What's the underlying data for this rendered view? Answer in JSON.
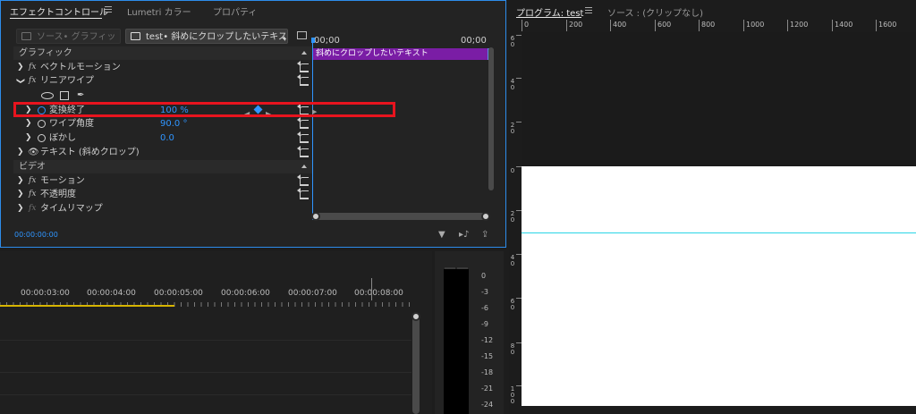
{
  "effect_controls": {
    "tabs": [
      {
        "label": "エフェクトコントロール",
        "active": true
      },
      {
        "label": "Lumetri カラー",
        "active": false
      },
      {
        "label": "プロパティ",
        "active": false
      }
    ],
    "source_button": "ソース• グラフィック",
    "clip_button": "test• 斜めにクロップしたいテキスト",
    "time_start": "00;00",
    "time_end": "00;00",
    "clip_bar_label": "斜めにクロップしたいテキスト",
    "rows": {
      "graphic_header": "グラフィック",
      "vector_motion": "ベクトルモーション",
      "linear_wipe": "リニアワイプ",
      "transition_completion": "変換終了",
      "transition_completion_value": "100 %",
      "wipe_angle": "ワイプ角度",
      "wipe_angle_value": "90.0 °",
      "feather": "ぼかし",
      "feather_value": "0.0",
      "text_layer": "テキスト (斜めクロップ)",
      "video_header": "ビデオ",
      "motion": "モーション",
      "opacity": "不透明度",
      "time_remap": "タイムリマップ"
    },
    "timecode": "00:00:00:00",
    "accent_color": "#2f95ff",
    "highlight_color": "#e8141e",
    "clip_color": "#7a1da5"
  },
  "timeline": {
    "ruler_labels": [
      "00:00:03:00",
      "00:00:04:00",
      "00:00:05:00",
      "00:00:06:00",
      "00:00:07:00",
      "00:00:08:00"
    ]
  },
  "audio_meter": {
    "scale": [
      "0",
      "-3",
      "-6",
      "-9",
      "-12",
      "-15",
      "-18",
      "-21",
      "-24"
    ]
  },
  "program_monitor": {
    "tabs": [
      {
        "label": "プログラム: test",
        "active": true
      },
      {
        "label": "ソース : (クリップなし)",
        "active": false
      }
    ],
    "hruler_labels": [
      "0",
      "200",
      "400",
      "600",
      "800",
      "1000",
      "1200",
      "1400",
      "1600"
    ],
    "vruler_labels": [
      "6 0",
      "4 0",
      "2 0",
      "0",
      "2 0",
      "4 0",
      "6 0",
      "8 0",
      "1 0 0"
    ]
  }
}
